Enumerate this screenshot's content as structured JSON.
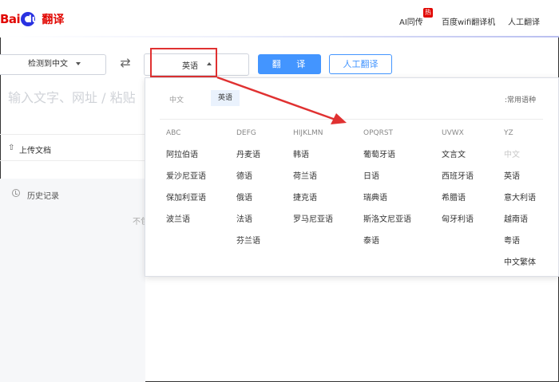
{
  "logo": {
    "bai": "Bai",
    "du": "du",
    "fanyi": "翻译"
  },
  "nav": {
    "items": [
      "AI同传",
      "百度wifi翻译机",
      "人工翻译"
    ],
    "hot_badge": "热"
  },
  "toolbar": {
    "source_lang": "检测到中文",
    "target_lang": "英语",
    "translate_button": "翻 译",
    "human_translate_button": "人工翻译"
  },
  "input": {
    "placeholder": "输入文字、网址 / 粘贴"
  },
  "upload": {
    "label": "上传文档"
  },
  "history": {
    "label": "历史记录",
    "empty_text": "不包"
  },
  "dropdown": {
    "tabs": [
      "中文",
      "英语"
    ],
    "active_tab": "英语",
    "common_langs_label": ":常用语种",
    "columns": [
      {
        "head": "ABC",
        "langs": [
          "阿拉伯语",
          "爱沙尼亚语",
          "保加利亚语",
          "波兰语"
        ]
      },
      {
        "head": "DEFG",
        "langs": [
          "丹麦语",
          "德语",
          "俄语",
          "法语",
          "芬兰语"
        ]
      },
      {
        "head": "HIJKLMN",
        "langs": [
          "韩语",
          "荷兰语",
          "捷克语",
          "罗马尼亚语"
        ]
      },
      {
        "head": "OPQRST",
        "langs": [
          "葡萄牙语",
          "日语",
          "瑞典语",
          "斯洛文尼亚语",
          "泰语"
        ]
      },
      {
        "head": "UVWX",
        "langs": [
          "文言文",
          "西班牙语",
          "希腊语",
          "匈牙利语"
        ]
      },
      {
        "head": "YZ",
        "langs": [
          "中文",
          "英语",
          "意大利语",
          "越南语",
          "粤语",
          "中文繁体"
        ]
      }
    ],
    "disabled_lang": "中文"
  },
  "colors": {
    "brand_red": "#e10601",
    "brand_blue": "#2932e1",
    "accent_blue": "#4395ff",
    "annotation_red": "#e03131"
  }
}
